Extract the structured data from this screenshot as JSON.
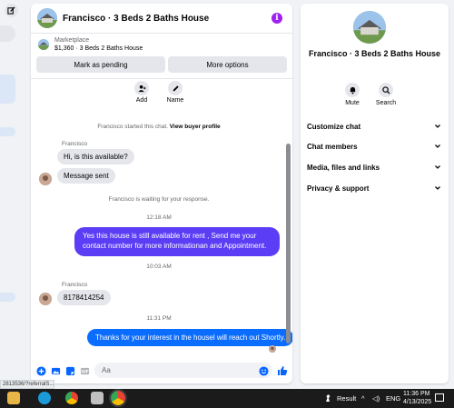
{
  "chat": {
    "title": "Francisco · 3 Beds 2 Baths House",
    "marketplace": {
      "label": "Marketplace",
      "price_title": "$1,360 · 3 Beds 2 Baths House",
      "mark_pending": "Mark as pending",
      "more_options": "More options"
    },
    "actions": [
      {
        "label": "Add",
        "icon": "add-user-icon"
      },
      {
        "label": "Name",
        "icon": "pencil-icon"
      }
    ],
    "started_text": "Francisco started this chat.",
    "view_profile": "View buyer profile",
    "sender_name_1": "Francisco",
    "msg_in_1": "Hi, is this available?",
    "msg_in_2": "Message sent",
    "waiting_text": "Francisco is waiting for your response.",
    "ts_1": "12:18 AM",
    "msg_out_1": "Yes this house is still available for rent , Send me your contact number for more informationan and Appointment.",
    "ts_2": "10:03 AM",
    "sender_name_2": "Francisco",
    "msg_in_3": "8178414254",
    "ts_3": "11:31 PM",
    "msg_out_2": "Thanks for your interest in the housel will reach out Shortly.",
    "composer_placeholder": "Aa"
  },
  "info_panel": {
    "title": "Francisco · 3 Beds 2 Baths House",
    "mute_label": "Mute",
    "search_label": "Search",
    "sections": [
      {
        "label": "Customize chat"
      },
      {
        "label": "Chat members"
      },
      {
        "label": "Media, files and links"
      },
      {
        "label": "Privacy & support"
      }
    ]
  },
  "status_url": "2813536/?referralS...",
  "taskbar": {
    "result_label": "Result",
    "lang": "ENG",
    "time": "11:36 PM",
    "date": "4/13/2025"
  },
  "colors": {
    "accent_purple": "#a020f0",
    "bubble_out": "#5b3df5",
    "bubble_blue": "#0b6dff",
    "messenger_blue": "#0866ff"
  }
}
